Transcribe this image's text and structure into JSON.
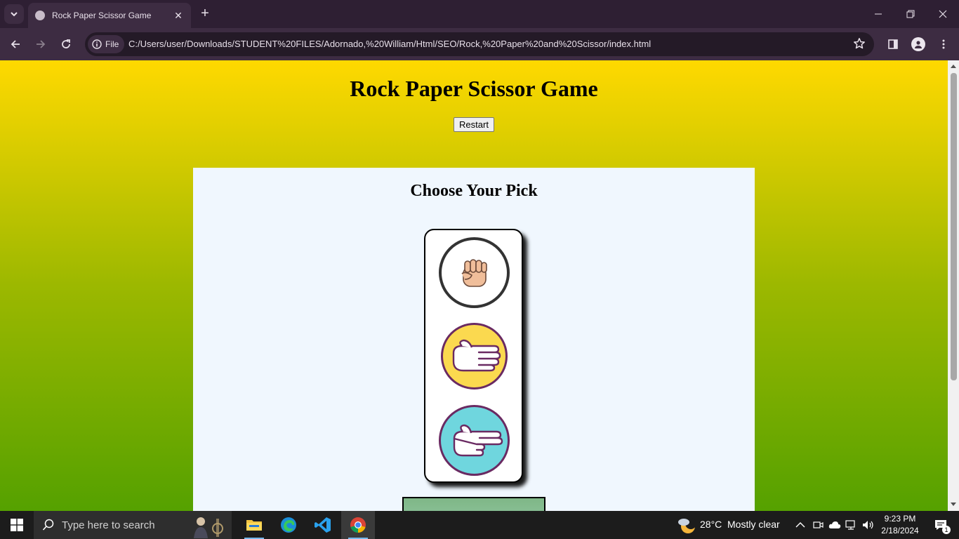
{
  "browser": {
    "tab_title": "Rock Paper Scissor Game",
    "close_tab": "✕",
    "new_tab": "+",
    "chip_label": "File",
    "url": "C:/Users/user/Downloads/STUDENT%20FILES/Adornado,%20William/Html/SEO/Rock,%20Paper%20and%20Scissor/index.html"
  },
  "page": {
    "title": "Rock Paper Scissor Game",
    "restart_label": "Restart",
    "choose_heading": "Choose Your Pick",
    "choices": [
      "rock",
      "paper",
      "scissor"
    ],
    "colors": {
      "gradient_top": "#ffd900",
      "gradient_bottom": "#55a100",
      "panel_bg": "#f0f7fe",
      "paper_bg": "#fbd94f",
      "scissor_bg": "#6fd6de",
      "ring": "#6a2a62"
    }
  },
  "taskbar": {
    "search_placeholder": "Type here to search",
    "weather_temp": "28°C",
    "weather_desc": "Mostly clear",
    "time": "9:23 PM",
    "date": "2/18/2024",
    "notification_count": "1",
    "apps": [
      "file-explorer",
      "edge",
      "vscode",
      "chrome"
    ]
  }
}
